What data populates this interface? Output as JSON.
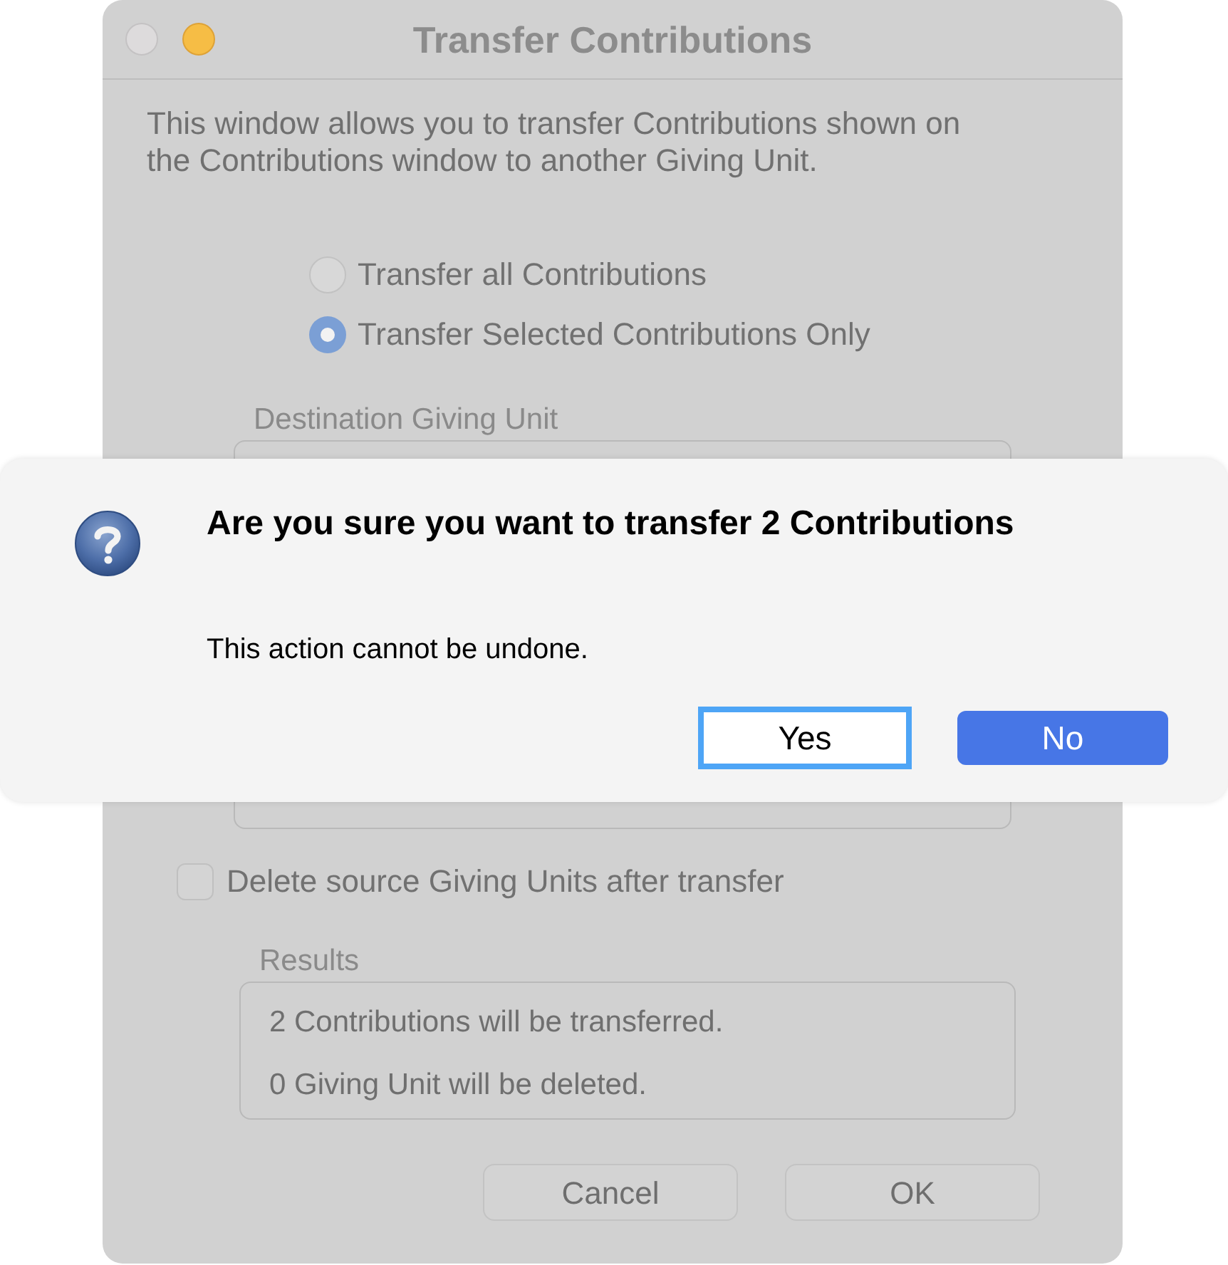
{
  "window": {
    "title": "Transfer Contributions",
    "controls": [
      {
        "kind": "close",
        "disabled": true
      },
      {
        "kind": "minimize",
        "disabled": false
      }
    ]
  },
  "description": "This window allows you to transfer Contributions shown on the Contributions window to another Giving Unit.",
  "transfer_options": [
    {
      "label": "Transfer all Contributions",
      "selected": false
    },
    {
      "label": "Transfer Selected Contributions Only",
      "selected": true
    }
  ],
  "destination": {
    "label": "Destination Giving Unit"
  },
  "delete_source": {
    "label": "Delete source Giving Units after transfer",
    "checked": false
  },
  "results": {
    "label": "Results",
    "lines": [
      "2 Contributions will be transferred.",
      "0 Giving Unit will be deleted."
    ]
  },
  "buttons": [
    "Cancel",
    "OK"
  ],
  "alert": {
    "title": "Are you sure you want to transfer 2 Contributions",
    "message": "This action cannot be undone.",
    "buttons": [
      {
        "label": "Yes",
        "kind": "focused"
      },
      {
        "label": "No",
        "kind": "default"
      }
    ]
  }
}
